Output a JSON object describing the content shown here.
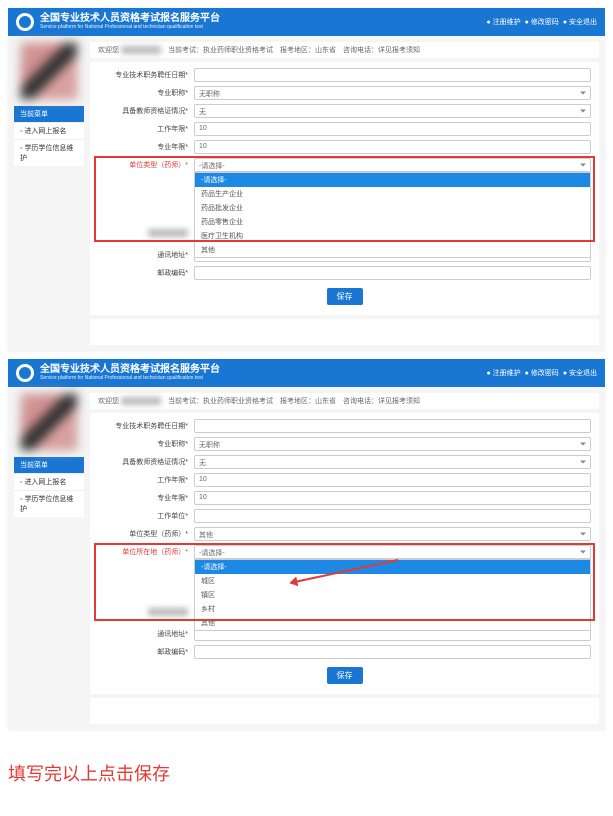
{
  "header": {
    "title": "全国专业技术人员资格考试报名服务平台",
    "subtitle": "Service platform for National Professional and technician qualification test",
    "links": [
      "注册维护",
      "修改密码",
      "安全退出"
    ]
  },
  "sidebar": {
    "head": "当前菜单",
    "items": [
      "进入网上报名",
      "学历学位信息维护"
    ]
  },
  "crumbs_prefix": "欢迎您",
  "crumbs": "当前考试：执业药师职业资格考试　报考地区：山东省　咨询电话：详见报考须知",
  "form": {
    "row1": {
      "label": "专业技术职务聘任日期*"
    },
    "row2": {
      "label": "专业职称*",
      "value": "无职称"
    },
    "row3": {
      "label": "具备教师资格证情况*",
      "value": "无"
    },
    "row4": {
      "label": "工作年限*",
      "value": "10"
    },
    "row5": {
      "label": "专业年限*",
      "value": "10"
    },
    "row6": {
      "label": "工作单位*",
      "value": ""
    },
    "row7": {
      "label": "单位类型（药师）*",
      "value": "-请选择-"
    },
    "row8": {
      "label": "",
      "value": ""
    },
    "row9": {
      "label": "通讯地址*"
    },
    "row10": {
      "label": "邮政编码*"
    }
  },
  "drop7": {
    "options": [
      "-请选择-",
      "药品生产企业",
      "药品批发企业",
      "药品零售企业",
      "医疗卫生机构",
      "其他"
    ]
  },
  "form2": {
    "row7": {
      "label": "单位类型（药师）*",
      "value": "其他"
    },
    "row8": {
      "label": "单位所在地（药师）*",
      "value": "-请选择-"
    }
  },
  "drop8": {
    "options": [
      "-请选择-",
      "城区",
      "镇区",
      "乡村",
      "其他"
    ]
  },
  "save": "保存",
  "caption": "填写完以上点击保存"
}
